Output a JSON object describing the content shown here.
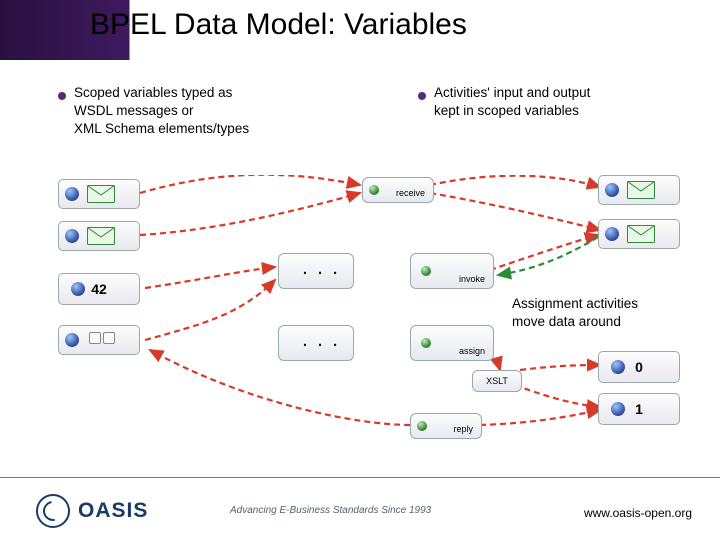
{
  "title": "BPEL Data Model: Variables",
  "bullets": {
    "left": "Scoped variables typed as\nWSDL messages or\nXML Schema elements/types",
    "right": "Activities' input and output\nkept in scoped variables"
  },
  "caption_right": "Assignment activities\nmove data around",
  "values": {
    "left_42": "42",
    "right_0": "0",
    "right_1": "1"
  },
  "activities": {
    "receive": "receive",
    "invoke": "invoke",
    "assign": "assign",
    "xslt": "XSLT",
    "reply": "reply",
    "ellipsis": ". . ."
  },
  "footer": {
    "logo": "OASIS",
    "tagline": "Advancing E-Business Standards Since 1993",
    "url": "www.oasis-open.org"
  },
  "colors": {
    "purple": "#2a1040",
    "accent": "#5a2a7a",
    "navy": "#1a3a6a",
    "red": "#d83a2a",
    "green": "#2e8b3a"
  }
}
